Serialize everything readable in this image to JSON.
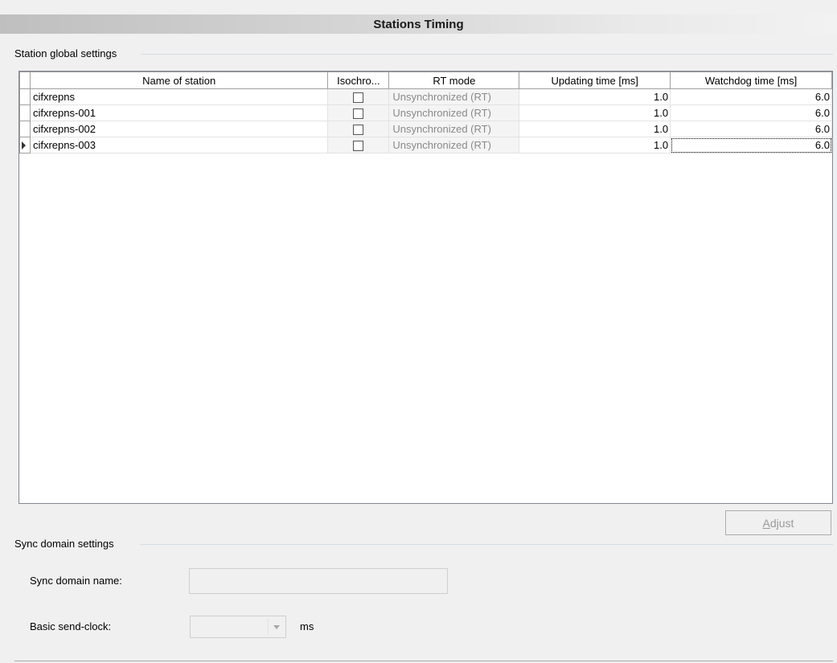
{
  "title": "Stations Timing",
  "station_group": {
    "label": "Station global settings",
    "columns": [
      "Name of station",
      "Isochro...",
      "RT mode",
      "Updating time [ms]",
      "Watchdog time [ms]"
    ],
    "rows": [
      {
        "name": "cifxrepns",
        "isochronous": false,
        "rt_mode": "Unsynchronized (RT)",
        "updating": "1.0",
        "watchdog": "6.0"
      },
      {
        "name": "cifxrepns-001",
        "isochronous": false,
        "rt_mode": "Unsynchronized (RT)",
        "updating": "1.0",
        "watchdog": "6.0"
      },
      {
        "name": "cifxrepns-002",
        "isochronous": false,
        "rt_mode": "Unsynchronized (RT)",
        "updating": "1.0",
        "watchdog": "6.0"
      },
      {
        "name": "cifxrepns-003",
        "isochronous": false,
        "rt_mode": "Unsynchronized (RT)",
        "updating": "1.0",
        "watchdog": "6.0"
      }
    ],
    "current_row": 3,
    "adjust_button": "Adjust"
  },
  "sync_group": {
    "label": "Sync domain settings",
    "domain_name_label": "Sync domain name:",
    "domain_name_value": "",
    "send_clock_label": "Basic send-clock:",
    "send_clock_value": "",
    "send_clock_unit": "ms"
  },
  "colors": {
    "disabled_text": "#8a8a8a",
    "grid_border": "#828790"
  }
}
